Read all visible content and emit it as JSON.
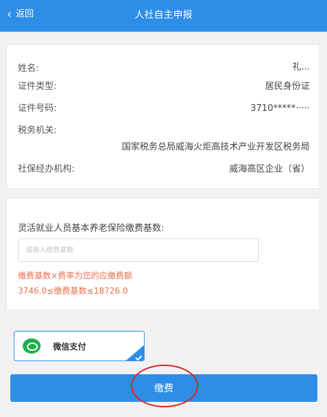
{
  "header": {
    "back_icon": "‹",
    "back_label": "返回",
    "title": "人社自主申报"
  },
  "info": {
    "name_label": "姓名:",
    "name_value": "礼...",
    "id_type_label": "证件类型:",
    "id_type_value": "居民身份证",
    "id_no_label": "证件号码:",
    "id_no_value": "3710*****·····",
    "tax_office_label": "税务机关:",
    "tax_office_value": "国家税务总局威海火炬高技术产业开发区税务局",
    "agency_label": "社保经办机构:",
    "agency_value": "威海高区企业（省）"
  },
  "base": {
    "label": "灵活就业人员基本养老保险缴费基数:",
    "placeholder": "请输入缴费基数",
    "hint_1": "缴费基数×费率为您的应缴费额",
    "hint_2": "3746.0≤缴费基数≤18726.0"
  },
  "payment": {
    "method_label": "微信支付",
    "method_icon": "wechat-icon",
    "pay_button": "缴费"
  },
  "colors": {
    "primary": "#2d8ee8",
    "hint": "#e8704f",
    "wechat": "#19b24a",
    "annotation": "#d9241a"
  }
}
